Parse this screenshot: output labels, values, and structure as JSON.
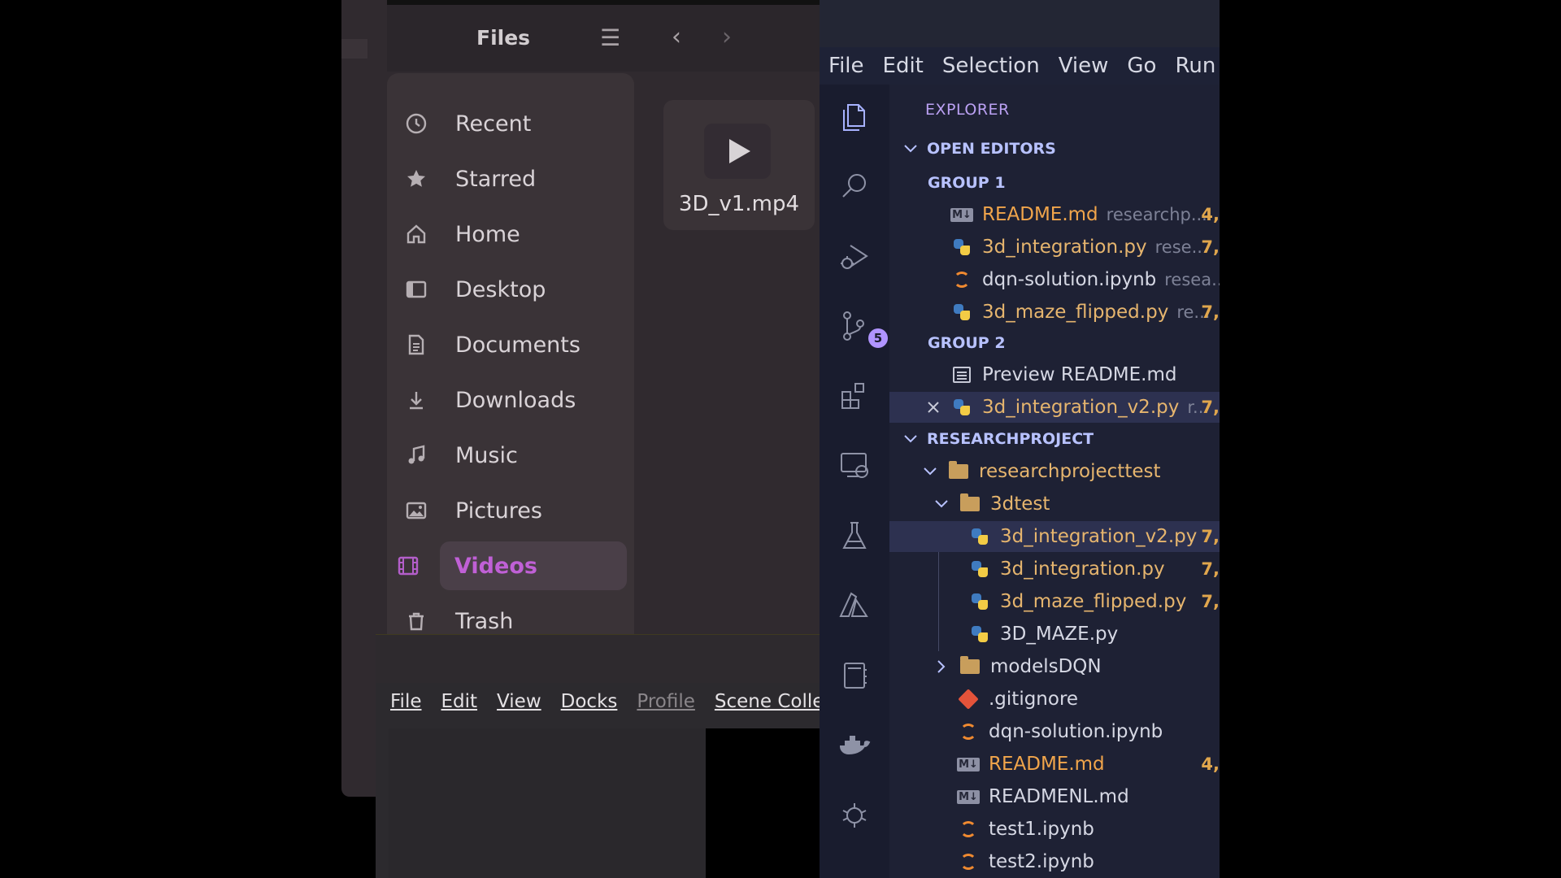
{
  "files": {
    "title": "Files",
    "sidebar": [
      {
        "label": "Recent",
        "icon": "clock-icon"
      },
      {
        "label": "Starred",
        "icon": "star-icon"
      },
      {
        "label": "Home",
        "icon": "home-icon"
      },
      {
        "label": "Desktop",
        "icon": "desktop-icon"
      },
      {
        "label": "Documents",
        "icon": "document-icon"
      },
      {
        "label": "Downloads",
        "icon": "download-icon"
      },
      {
        "label": "Music",
        "icon": "music-icon"
      },
      {
        "label": "Pictures",
        "icon": "picture-icon"
      },
      {
        "label": "Videos",
        "icon": "video-icon",
        "active": true
      },
      {
        "label": "Trash",
        "icon": "trash-icon"
      }
    ],
    "content": {
      "items": [
        {
          "name": "3D_v1.mp4",
          "icon": "play-icon"
        }
      ]
    },
    "accent_color": "#c060d6"
  },
  "obs": {
    "menu": [
      "File",
      "Edit",
      "View",
      "Docks",
      "Profile",
      "Scene Collec"
    ]
  },
  "vscode": {
    "menu": [
      "File",
      "Edit",
      "Selection",
      "View",
      "Go",
      "Run"
    ],
    "source_control_badge": "5",
    "explorer": {
      "title": "EXPLORER",
      "open_editors": {
        "title": "OPEN EDITORS",
        "groups": [
          {
            "label": "GROUP 1",
            "items": [
              {
                "name": "README.md",
                "path": "researchp...",
                "count": "4,",
                "type": "md"
              },
              {
                "name": "3d_integration.py",
                "path": "rese...",
                "count": "7,",
                "type": "py"
              },
              {
                "name": "dqn-solution.ipynb",
                "path": "resea...",
                "count": "",
                "type": "nb"
              },
              {
                "name": "3d_maze_flipped.py",
                "path": "re...",
                "count": "7,",
                "type": "py"
              }
            ]
          },
          {
            "label": "GROUP 2",
            "items": [
              {
                "name": "Preview README.md",
                "path": "",
                "count": "",
                "type": "preview"
              },
              {
                "name": "3d_integration_v2.py",
                "path": "r...",
                "count": "7,",
                "type": "py",
                "selected": true
              }
            ]
          }
        ]
      },
      "project": {
        "title": "RESEARCHPROJECT",
        "tree": [
          {
            "name": "researchprojecttest",
            "type": "folder",
            "expanded": true
          },
          {
            "name": "3dtest",
            "type": "folder",
            "expanded": true
          },
          {
            "name": "3d_integration_v2.py",
            "type": "py",
            "count": "7,",
            "selected": true
          },
          {
            "name": "3d_integration.py",
            "type": "py",
            "count": "7,"
          },
          {
            "name": "3d_maze_flipped.py",
            "type": "py",
            "count": "7,"
          },
          {
            "name": "3D_MAZE.py",
            "type": "py",
            "count": ""
          },
          {
            "name": "modelsDQN",
            "type": "folder",
            "expanded": false
          },
          {
            "name": ".gitignore",
            "type": "git",
            "count": ""
          },
          {
            "name": "dqn-solution.ipynb",
            "type": "nb",
            "count": ""
          },
          {
            "name": "README.md",
            "type": "md",
            "count": "4,"
          },
          {
            "name": "READMENL.md",
            "type": "md",
            "count": ""
          },
          {
            "name": "test1.ipynb",
            "type": "nb",
            "count": ""
          },
          {
            "name": "test2.ipynb",
            "type": "nb",
            "count": ""
          }
        ]
      }
    }
  }
}
